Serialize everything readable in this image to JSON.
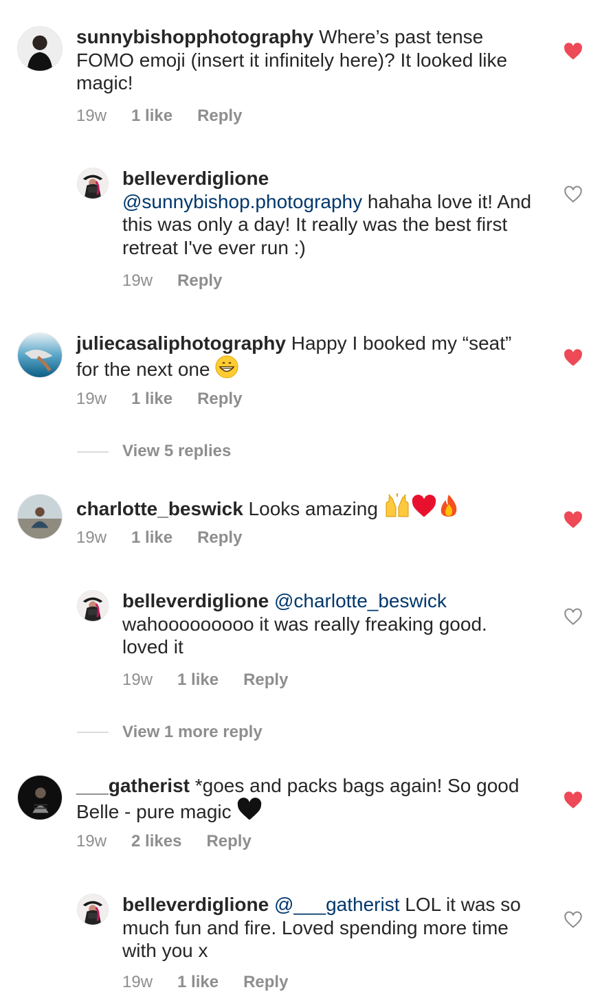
{
  "colors": {
    "liked_heart": "#ed4956",
    "unliked_heart": "#8e8e8e",
    "mention": "#00376b",
    "meta": "#8e8e8e"
  },
  "comments": [
    {
      "username": "sunnybishopphotography",
      "text": " Where’s past tense FOMO emoji (insert it infinitely here)? It looked like magic!",
      "time": "19w",
      "likes": "1 like",
      "reply": "Reply",
      "liked": true
    },
    {
      "username": "belleverdiglione",
      "mention": "@sunnybishop.photography",
      "text": " hahaha love it! And this was only a day! It really was the best first retreat I've ever run :)",
      "time": "19w",
      "reply": "Reply",
      "liked": false
    },
    {
      "username": "juliecasaliphotography",
      "text": " Happy I booked my “seat” for the next one ",
      "time": "19w",
      "likes": "1 like",
      "reply": "Reply",
      "liked": true,
      "view_replies": "View 5 replies"
    },
    {
      "username": "charlotte_beswick",
      "text": " Looks amazing ",
      "time": "19w",
      "likes": "1 like",
      "reply": "Reply",
      "liked": true
    },
    {
      "username": "belleverdiglione",
      "mention": "@charlotte_beswick",
      "text": " wahooooooooo it was really freaking good. loved it",
      "time": "19w",
      "likes": "1 like",
      "reply": "Reply",
      "liked": false,
      "view_replies": "View 1 more reply"
    },
    {
      "username": "___gatherist",
      "text": " *goes and packs bags again! So good Belle - pure magic ",
      "time": "19w",
      "likes": "2 likes",
      "reply": "Reply",
      "liked": true
    },
    {
      "username": "belleverdiglione",
      "mention": "@___gatherist",
      "text": " LOL it was so much fun and fire. Loved spending more time with you x",
      "time": "19w",
      "likes": "1 like",
      "reply": "Reply",
      "liked": false
    }
  ]
}
